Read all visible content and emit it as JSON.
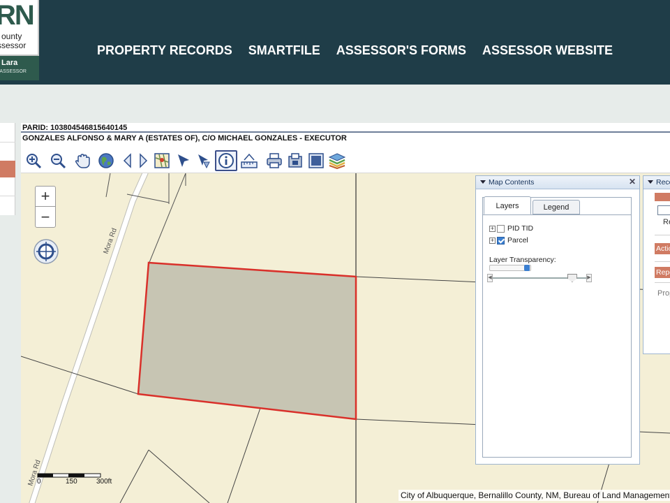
{
  "header": {
    "logo": {
      "mark": "RN",
      "sub1": "ounty",
      "sub2": "ssessor",
      "name": "Lara",
      "role": "NTY ASSESSOR"
    },
    "nav": [
      "PROPERTY RECORDS",
      "SMARTFILE",
      "ASSESSOR'S FORMS",
      "ASSESSOR WEBSITE"
    ]
  },
  "parcel": {
    "parid": "PARID: 103804546815640145",
    "owner": "GONZALES ALFONSO & MARY A (ESTATES OF), C/O MICHAEL GONZALES - EXECUTOR"
  },
  "toolbar": {
    "tools": [
      "zoom-in-icon",
      "zoom-out-icon",
      "pan-hand-icon",
      "full-extent-globe-icon",
      "previous-extent-icon",
      "next-extent-icon",
      "map-view-icon",
      "select-arrow-icon",
      "select-arrow-alt-icon",
      "identify-info-icon",
      "measure-icon",
      "print-icon",
      "export-icon",
      "screenshot-icon",
      "layers-icon"
    ],
    "active_tool": "identify-info-icon"
  },
  "map": {
    "zoom_in": "+",
    "zoom_out": "−",
    "road_label_1": "Mora Rd",
    "road_label_2": "Mora Rd",
    "scale": {
      "labels": [
        "0",
        "150",
        "300ft"
      ]
    },
    "attribution": "City of Albuquerque, Bernalillo County, NM, Bureau of Land Management",
    "colors": {
      "land": "#f4efd6",
      "parcel_fill": "#c7c5b3",
      "parcel_stroke": "#d9302a"
    }
  },
  "map_contents": {
    "title": "Map Contents",
    "close": "✕",
    "tabs": [
      "Layers",
      "Legend"
    ],
    "active_tab": "Layers",
    "layers": [
      {
        "label": "PID TID",
        "checked": false
      },
      {
        "label": "Parcel",
        "checked": true
      }
    ],
    "transparency_label": "Layer Transparency:",
    "transparency_level": 0.85
  },
  "record_panel": {
    "title": "Record",
    "r_label": "Re",
    "actions_label": "Actions",
    "reports_label": "Reports",
    "prop_label": "Property"
  }
}
